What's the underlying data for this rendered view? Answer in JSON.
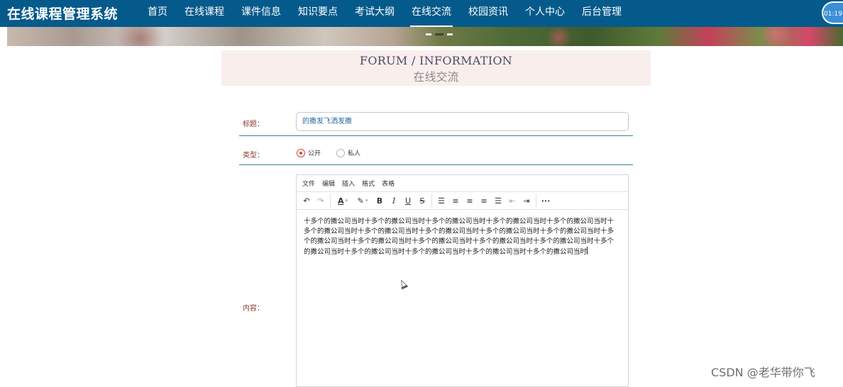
{
  "app": {
    "title": "在线课程管理系统",
    "clock": "01:19"
  },
  "nav": {
    "items": [
      {
        "label": "首页"
      },
      {
        "label": "在线课程"
      },
      {
        "label": "课件信息"
      },
      {
        "label": "知识要点"
      },
      {
        "label": "考试大纲"
      },
      {
        "label": "在线交流",
        "active": true
      },
      {
        "label": "校园资讯"
      },
      {
        "label": "个人中心"
      },
      {
        "label": "后台管理"
      }
    ]
  },
  "section": {
    "title_en": "FORUM / INFORMATION",
    "title_cn": "在线交流"
  },
  "form": {
    "title_label": "标题：",
    "title_value": "的撒发飞洒发撒",
    "type_label": "类型：",
    "type_options": [
      {
        "label": "公开",
        "checked": true
      },
      {
        "label": "私人",
        "checked": false
      }
    ],
    "content_label": "内容："
  },
  "editor": {
    "menus": [
      "文件",
      "编辑",
      "插入",
      "格式",
      "表格"
    ],
    "content": "十多个的撒公司当时十多个的撒公司当时十多个的撒公司当时十多个的撒公司当时十多个的撒公司当时十多个的撒公司当时十多个的撒公司当时十多个的撒公司当时十多个的撒公司当时十多个的撒公司当时十多个的撒公司当时十多个的撒公司当时十多个的撒公司当时十多个的撒公司当时十多个的撒公司当时十多个的撒公司当时十多个的撒公司当时十多个的撒公司当时十多个的撒公司当时十多个的撒公司当时"
  },
  "watermark": "CSDN @老华带你飞",
  "colors": {
    "nav_bg": "#055a8c",
    "label": "#8a3b2f",
    "divider": "#3c7f8b",
    "heading_bg": "#f9eeec",
    "radio_accent": "#d24a3a"
  }
}
